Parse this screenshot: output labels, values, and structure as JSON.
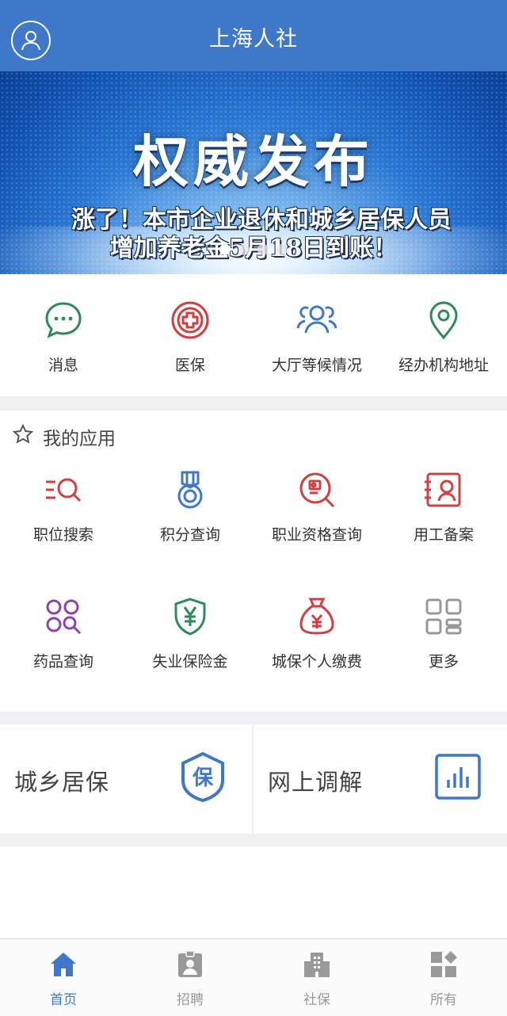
{
  "header": {
    "title": "上海人社",
    "avatar_icon": "user-icon"
  },
  "banner": {
    "headline": "权威发布",
    "subtitle_line1": "涨了！本市企业退休和城乡居保人员",
    "subtitle_line2": "增加养老金5月18日到账！",
    "pager_count": 4,
    "pager_active": 0
  },
  "quick_access": [
    {
      "label": "消息",
      "icon": "message-icon",
      "color": "#2e8b57"
    },
    {
      "label": "医保",
      "icon": "medical-cross-icon",
      "color": "#d23f3f"
    },
    {
      "label": "大厅等候情况",
      "icon": "people-group-icon",
      "color": "#3f78c9"
    },
    {
      "label": "经办机构地址",
      "icon": "location-pin-icon",
      "color": "#2e8b57"
    }
  ],
  "my_apps": {
    "title": "我的应用",
    "title_icon": "star-outline-icon",
    "items": [
      {
        "label": "职位搜索",
        "icon": "job-search-icon",
        "color": "#d23f3f"
      },
      {
        "label": "积分查询",
        "icon": "medal-icon",
        "color": "#3f78c9"
      },
      {
        "label": "职业资格查询",
        "icon": "certificate-search-icon",
        "color": "#d23f3f"
      },
      {
        "label": "用工备案",
        "icon": "id-card-icon",
        "color": "#d23f3f"
      },
      {
        "label": "药品查询",
        "icon": "pills-search-icon",
        "color": "#8e44ad"
      },
      {
        "label": "失业保险金",
        "icon": "shield-yen-icon",
        "color": "#2e8b57"
      },
      {
        "label": "城保个人缴费",
        "icon": "money-bag-icon",
        "color": "#d23f3f"
      },
      {
        "label": "更多",
        "icon": "grid-more-icon",
        "color": "#999999"
      }
    ]
  },
  "cards": [
    {
      "label": "城乡居保",
      "icon": "shield-bao-icon",
      "icon_text": "保",
      "color": "#3f78c9"
    },
    {
      "label": "网上调解",
      "icon": "bar-chart-icon",
      "color": "#3f78c9"
    }
  ],
  "tabbar": [
    {
      "label": "首页",
      "icon": "home-icon",
      "active": true
    },
    {
      "label": "招聘",
      "icon": "badge-icon",
      "active": false
    },
    {
      "label": "社保",
      "icon": "building-icon",
      "active": false
    },
    {
      "label": "所有",
      "icon": "apps-icon",
      "active": false
    }
  ],
  "colors": {
    "primary": "#3f78c9",
    "green": "#2e8b57",
    "red": "#d23f3f",
    "purple": "#8e44ad",
    "gray": "#999999"
  }
}
